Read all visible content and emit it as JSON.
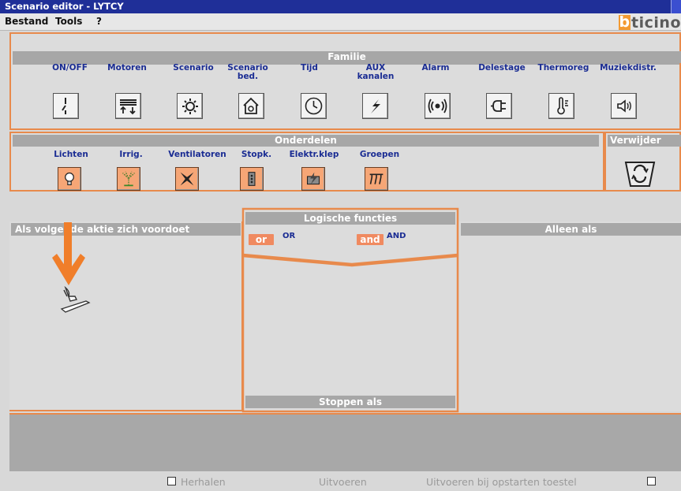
{
  "window": {
    "title": "Scenario editor - LYTCY"
  },
  "menu": {
    "items": [
      {
        "label": "Bestand"
      },
      {
        "label": "Tools"
      },
      {
        "label": "?"
      }
    ]
  },
  "logo": {
    "mark": "b",
    "text": "ticino"
  },
  "familie": {
    "title": "Familie",
    "items": [
      {
        "label": "ON/OFF",
        "icon": "switch-icon"
      },
      {
        "label": "Motoren",
        "icon": "motor-icon"
      },
      {
        "label": "Scenario",
        "icon": "scenario-icon"
      },
      {
        "label": "Scenario bed.",
        "icon": "scenario-house-icon"
      },
      {
        "label": "Tijd",
        "icon": "clock-icon"
      },
      {
        "label": "AUX kanalen",
        "icon": "lightning-icon"
      },
      {
        "label": "Alarm",
        "icon": "alarm-icon"
      },
      {
        "label": "Delestage",
        "icon": "plug-icon"
      },
      {
        "label": "Thermoreg",
        "icon": "thermometer-icon"
      },
      {
        "label": "Muziekdistr.",
        "icon": "speaker-icon"
      }
    ]
  },
  "onderdelen": {
    "title": "Onderdelen",
    "items": [
      {
        "label": "Lichten",
        "icon": "lightbulb-icon"
      },
      {
        "label": "Irrig.",
        "icon": "sprinkler-icon"
      },
      {
        "label": "Ventilatoren",
        "icon": "fan-icon"
      },
      {
        "label": "Stopk.",
        "icon": "socket-icon"
      },
      {
        "label": "Elektr.klep",
        "icon": "valve-icon"
      },
      {
        "label": "Groepen",
        "icon": "groups-icon"
      }
    ]
  },
  "verwijder": {
    "title": "Verwijder",
    "icon": "recycle-bin-icon"
  },
  "sections": {
    "trigger_title": "Als volgende aktie zich voordoet",
    "logic_title": "Logische functies",
    "only_if_title": "Alleen als",
    "stop_title": "Stoppen als"
  },
  "logic": {
    "or_button": "or",
    "or_label": "OR",
    "and_button": "and",
    "and_label": "AND"
  },
  "colors": {
    "titlebar": "#1f2f98",
    "accent": "#e88a4c",
    "label_blue": "#1a2c93",
    "panel_head": "#a7a7a7"
  },
  "footer": {
    "repeat_label": "Herhalen",
    "execute_label": "Uitvoeren",
    "execute_on_start_label": "Uitvoeren bij opstarten toestel"
  }
}
